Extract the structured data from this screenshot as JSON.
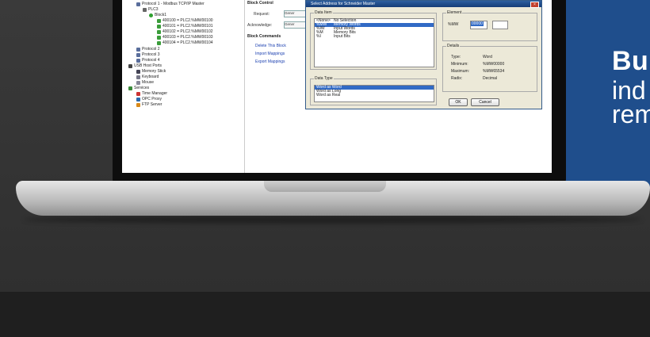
{
  "tree": {
    "items": [
      {
        "label": "Protocol 1 - Modbus TCP/IP Master"
      },
      {
        "label": "PLC3"
      },
      {
        "label": "Block1"
      },
      {
        "label": "400100 = PLC2.%MW00100"
      },
      {
        "label": "400101 = PLC2.%MW00101"
      },
      {
        "label": "400102 = PLC2.%MW00102"
      },
      {
        "label": "400103 = PLC2.%MW00103"
      },
      {
        "label": "400104 = PLC2.%MW00104"
      },
      {
        "label": "Protocol 2"
      },
      {
        "label": "Protocol 3"
      },
      {
        "label": "Protocol 4"
      },
      {
        "label": "USB Host Ports"
      },
      {
        "label": "Memory Stick"
      },
      {
        "label": "Keyboard"
      },
      {
        "label": "Mouse"
      },
      {
        "label": "Services"
      },
      {
        "label": "Time Manager"
      },
      {
        "label": "OPC Proxy"
      },
      {
        "label": "FTP Server"
      }
    ]
  },
  "panel": {
    "block_control": "Block Control",
    "request_label": "Request:",
    "request_value": "Gener",
    "acknowledge_label": "Acknowledge:",
    "acknowledge_value": "Gener",
    "block_commands": "Block Commands",
    "delete_block": "Delete This Block",
    "import_mappings": "Import Mappings",
    "export_mappings": "Export Mappings"
  },
  "dialog": {
    "title": "Select Address for Schneider Master",
    "close": "×",
    "data_item_label": "Data Item",
    "data_items": [
      {
        "code": "<None>",
        "desc": "No Selection",
        "selected": false
      },
      {
        "code": "%MW",
        "desc": "Memory Words",
        "selected": true
      },
      {
        "code": "%IW",
        "desc": "Input Words",
        "selected": false
      },
      {
        "code": "%M",
        "desc": "Memory Bits",
        "selected": false
      },
      {
        "code": "%I",
        "desc": "Input Bits",
        "selected": false
      }
    ],
    "element_label": "Element",
    "element_prefix": "%MW",
    "element_value": "00000",
    "details_label": "Details",
    "details": [
      {
        "key": "Type:",
        "value": "Word"
      },
      {
        "key": "Minimum:",
        "value": "%MW00000"
      },
      {
        "key": "Maximum:",
        "value": "%MW65534"
      },
      {
        "key": "Radix:",
        "value": "Decimal"
      }
    ],
    "data_type_label": "Data Type",
    "data_types": [
      {
        "label": "Word as Word",
        "selected": true
      },
      {
        "label": "Word as Long",
        "selected": false
      },
      {
        "label": "Word as Real",
        "selected": false
      }
    ],
    "ok": "OK",
    "cancel": "Cancel"
  },
  "banner": {
    "line1": "Bu",
    "line2": "ind",
    "line3": "rem"
  }
}
